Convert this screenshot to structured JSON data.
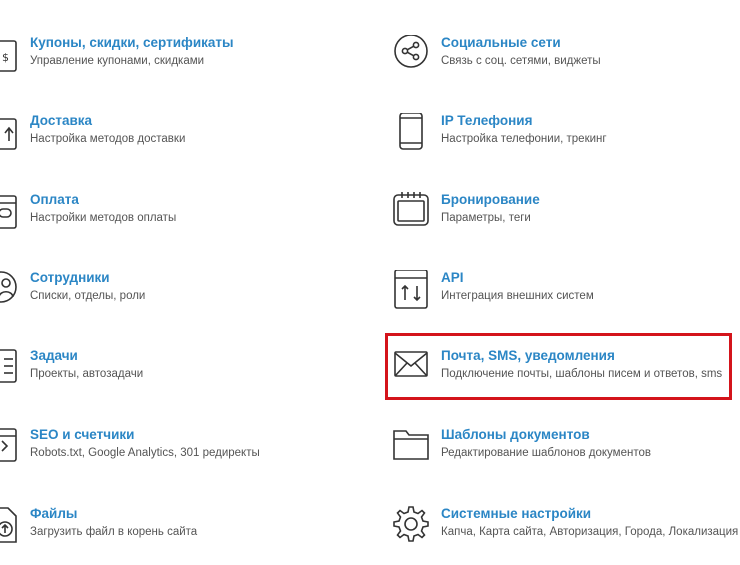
{
  "left_column": [
    {
      "title": "Купоны, скидки, сертификаты",
      "desc": "Управление купонами, скидками",
      "icon": "coupon-icon"
    },
    {
      "title": "Доставка",
      "desc": "Настройка методов доставки",
      "icon": "delivery-icon"
    },
    {
      "title": "Оплата",
      "desc": "Настройки методов оплаты",
      "icon": "payment-icon"
    },
    {
      "title": "Сотрудники",
      "desc": "Списки, отделы, роли",
      "icon": "employees-icon"
    },
    {
      "title": "Задачи",
      "desc": "Проекты, автозадачи",
      "icon": "tasks-icon"
    },
    {
      "title": "SEO и счетчики",
      "desc": "Robots.txt, Google Analytics, 301 редиректы",
      "icon": "seo-icon"
    },
    {
      "title": "Файлы",
      "desc": "Загрузить файл в корень сайта",
      "icon": "files-icon"
    }
  ],
  "right_column": [
    {
      "title": "Социальные сети",
      "desc": "Связь с соц. сетями, виджеты",
      "icon": "share-icon"
    },
    {
      "title": "IP Телефония",
      "desc": "Настройка телефонии, трекинг",
      "icon": "phone-icon"
    },
    {
      "title": "Бронирование",
      "desc": "Параметры, теги",
      "icon": "calendar-icon"
    },
    {
      "title": "API",
      "desc": "Интеграция внешних систем",
      "icon": "api-icon"
    },
    {
      "title": "Почта, SMS, уведомления",
      "desc": "Подключение почты, шаблоны писем и ответов, sms",
      "icon": "mail-icon",
      "highlighted": true
    },
    {
      "title": "Шаблоны документов",
      "desc": "Редактирование шаблонов документов",
      "icon": "folder-icon"
    },
    {
      "title": "Системные настройки",
      "desc": "Капча, Карта сайта, Авторизация, Города, Локализация",
      "icon": "gear-icon"
    }
  ],
  "colors": {
    "title": "#2b86c5",
    "desc": "#545454",
    "icon": "#333333",
    "highlight": "#d4141b"
  }
}
